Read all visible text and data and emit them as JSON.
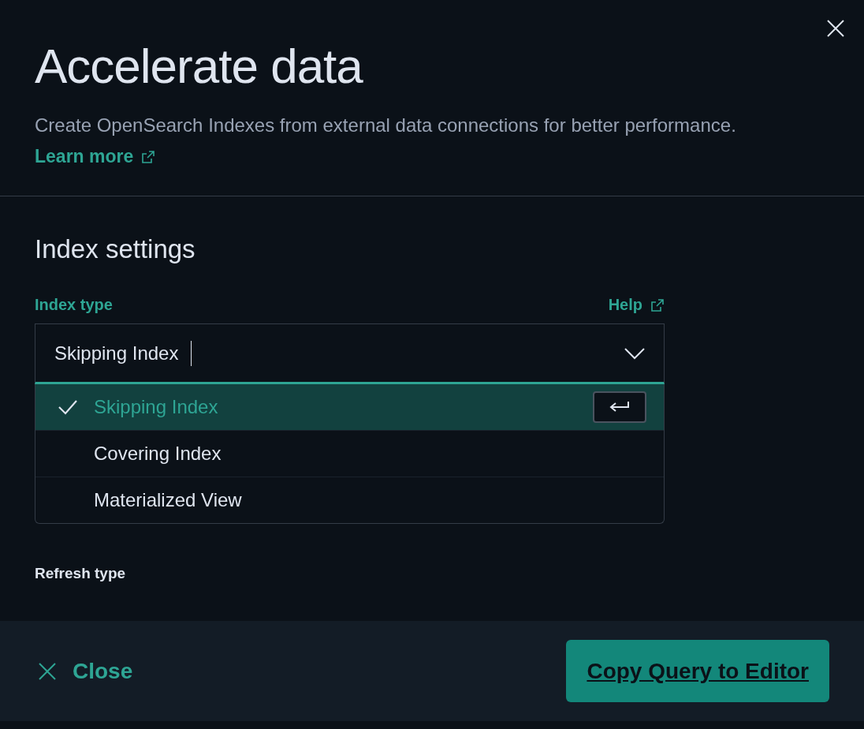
{
  "flyout": {
    "title": "Accelerate data",
    "description": "Create OpenSearch Indexes from external data connections for better performance.",
    "learn_more": "Learn more"
  },
  "index_settings": {
    "heading": "Index settings",
    "index_type": {
      "label": "Index type",
      "help": "Help",
      "value": "Skipping Index",
      "options": [
        {
          "label": "Skipping Index",
          "selected": true
        },
        {
          "label": "Covering Index",
          "selected": false
        },
        {
          "label": "Materialized View",
          "selected": false
        }
      ]
    },
    "refresh_type_label": "Refresh type"
  },
  "footer": {
    "close": "Close",
    "primary": "Copy Query to Editor"
  }
}
